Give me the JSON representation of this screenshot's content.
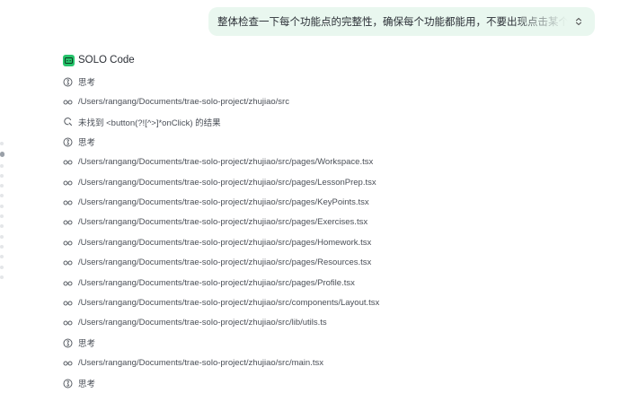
{
  "user_message": {
    "text": "整体检查一下每个功能点的完整性，确保每个功能都能用，不要出现点击某个功能没反应的情况"
  },
  "agent": {
    "name": "SOLO Code",
    "steps": [
      {
        "icon": "think",
        "text": "思考"
      },
      {
        "icon": "view",
        "text": "/Users/rangang/Documents/trae-solo-project/zhujiao/src"
      },
      {
        "icon": "search",
        "text": "未找到 <button(?![^>]*onClick) 的结果"
      },
      {
        "icon": "think",
        "text": "思考"
      },
      {
        "icon": "view",
        "text": "/Users/rangang/Documents/trae-solo-project/zhujiao/src/pages/Workspace.tsx"
      },
      {
        "icon": "view",
        "text": "/Users/rangang/Documents/trae-solo-project/zhujiao/src/pages/LessonPrep.tsx"
      },
      {
        "icon": "view",
        "text": "/Users/rangang/Documents/trae-solo-project/zhujiao/src/pages/KeyPoints.tsx"
      },
      {
        "icon": "view",
        "text": "/Users/rangang/Documents/trae-solo-project/zhujiao/src/pages/Exercises.tsx"
      },
      {
        "icon": "view",
        "text": "/Users/rangang/Documents/trae-solo-project/zhujiao/src/pages/Homework.tsx"
      },
      {
        "icon": "view",
        "text": "/Users/rangang/Documents/trae-solo-project/zhujiao/src/pages/Resources.tsx"
      },
      {
        "icon": "view",
        "text": "/Users/rangang/Documents/trae-solo-project/zhujiao/src/pages/Profile.tsx"
      },
      {
        "icon": "view",
        "text": "/Users/rangang/Documents/trae-solo-project/zhujiao/src/components/Layout.tsx"
      },
      {
        "icon": "view",
        "text": "/Users/rangang/Documents/trae-solo-project/zhujiao/src/lib/utils.ts"
      },
      {
        "icon": "think",
        "text": "思考"
      },
      {
        "icon": "view",
        "text": "/Users/rangang/Documents/trae-solo-project/zhujiao/src/main.tsx"
      },
      {
        "icon": "think",
        "text": "思考"
      }
    ]
  },
  "scroll_rail": {
    "count": 14,
    "active_index": 1
  },
  "colors": {
    "bubble_bg": "#e9f7ef",
    "logo_green": "#27c46c",
    "text": "#2b2f36"
  }
}
